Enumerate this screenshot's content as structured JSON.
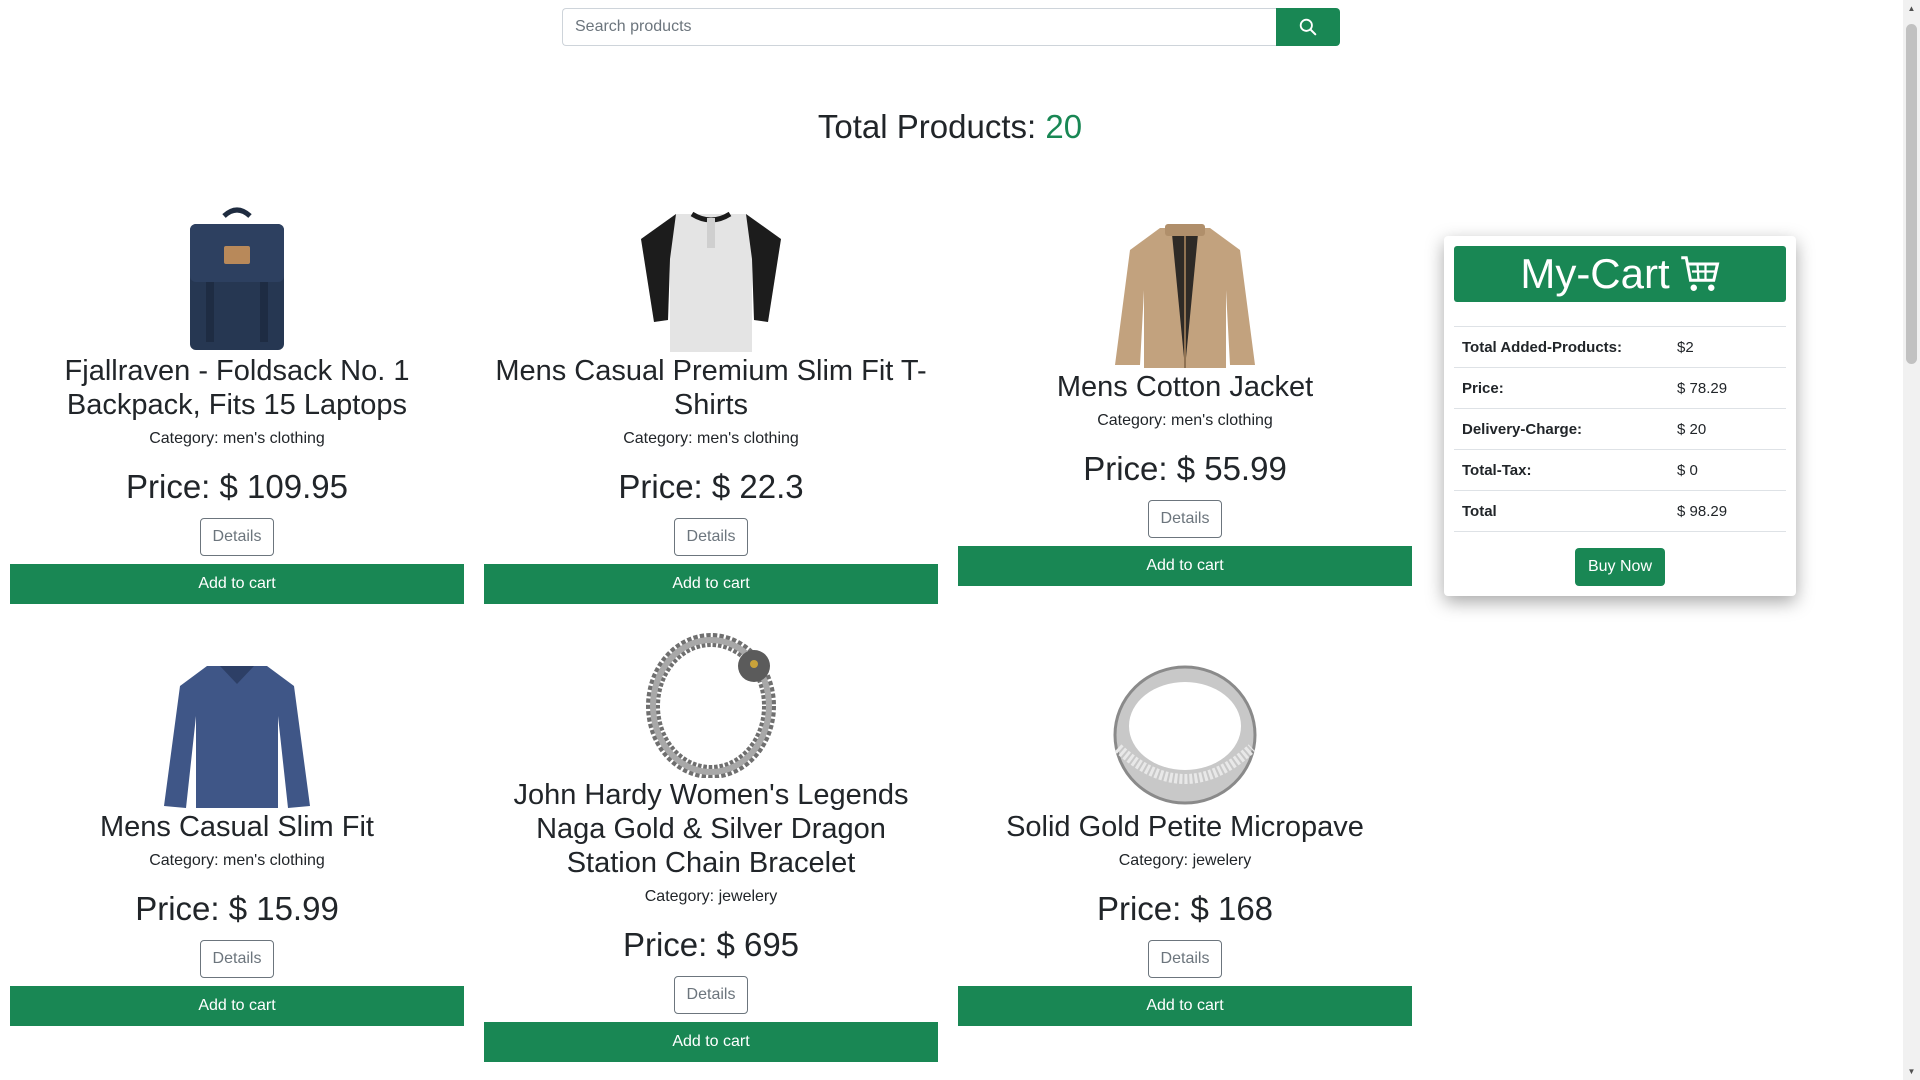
{
  "search": {
    "placeholder": "Search products",
    "button_icon": "search-icon"
  },
  "summary": {
    "label": "Total Products:",
    "count": "20"
  },
  "products": [
    {
      "title": "Fjallraven - Foldsack No. 1 Backpack, Fits 15 Laptops",
      "category": "Category: men's clothing",
      "price": "Price: $ 109.95",
      "details_label": "Details",
      "add_label": "Add to cart",
      "image": "backpack-image"
    },
    {
      "title": "Mens Casual Premium Slim Fit T-Shirts",
      "category": "Category: men's clothing",
      "price": "Price: $ 22.3",
      "details_label": "Details",
      "add_label": "Add to cart",
      "image": "tshirt-image"
    },
    {
      "title": "Mens Cotton Jacket",
      "category": "Category: men's clothing",
      "price": "Price: $ 55.99",
      "details_label": "Details",
      "add_label": "Add to cart",
      "image": "jacket-image"
    },
    {
      "title": "Mens Casual Slim Fit",
      "category": "Category: men's clothing",
      "price": "Price: $ 15.99",
      "details_label": "Details",
      "add_label": "Add to cart",
      "image": "longsleeve-image"
    },
    {
      "title": "John Hardy Women's Legends Naga Gold & Silver Dragon Station Chain Bracelet",
      "category": "Category: jewelery",
      "price": "Price: $ 695",
      "details_label": "Details",
      "add_label": "Add to cart",
      "image": "bracelet-image"
    },
    {
      "title": "Solid Gold Petite Micropave",
      "category": "Category: jewelery",
      "price": "Price: $ 168",
      "details_label": "Details",
      "add_label": "Add to cart",
      "image": "ring-image"
    }
  ],
  "cart": {
    "title": "My-Cart",
    "icon": "cart-icon",
    "rows": [
      {
        "label": "Total Added-Products:",
        "value": "$2"
      },
      {
        "label": "Price:",
        "value": "$ 78.29"
      },
      {
        "label": "Delivery-Charge:",
        "value": "$ 20"
      },
      {
        "label": "Total-Tax:",
        "value": "$ 0"
      },
      {
        "label": "Total",
        "value": "$ 98.29"
      }
    ],
    "buy_label": "Buy Now"
  },
  "colors": {
    "accent": "#198754",
    "text": "#212529",
    "muted": "#6c757d"
  }
}
